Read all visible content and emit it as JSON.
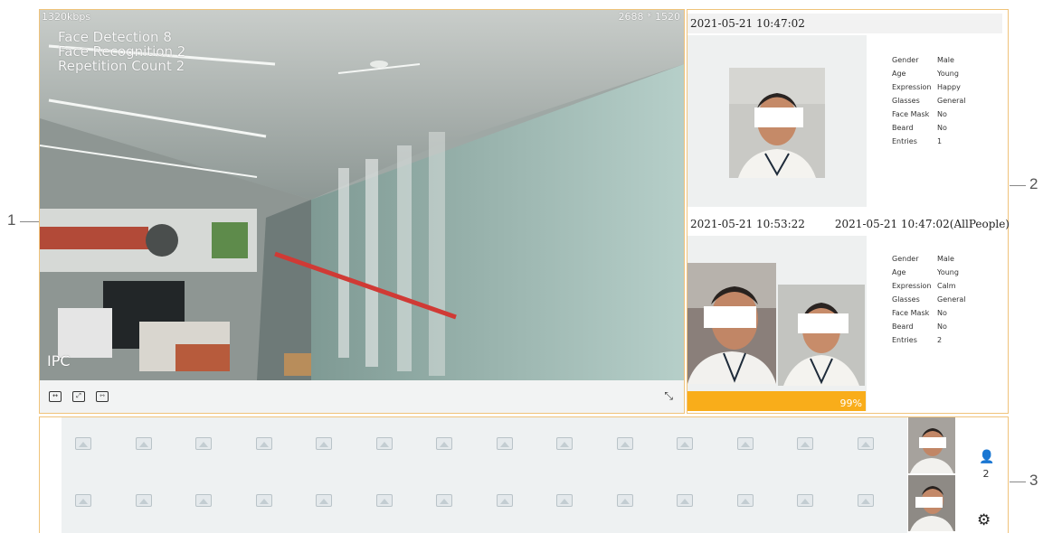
{
  "callouts": {
    "one": "1",
    "two": "2",
    "three": "3"
  },
  "video": {
    "bitrate": "1320kbps",
    "resolution": "2688 * 1520",
    "stats": {
      "face_detection": "Face Detection  8",
      "face_recognition": "Face Recognition  2",
      "repetition_count": "Repetition Count  2"
    },
    "channel_label": "IPC",
    "toolbar": {
      "btn1_icon": "stretch-icon",
      "btn2_icon": "zoom-icon",
      "btn3_icon": "ratio-icon",
      "fullscreen_icon": "fullscreen-icon",
      "btn1_glyph": "↔",
      "btn2_glyph": "⤢",
      "btn3_glyph": "⇿",
      "fullscreen_glyph": "⤡"
    }
  },
  "snapshot": {
    "timestamp": "2021-05-21 10:47:02",
    "attributes": [
      {
        "key": "Gender",
        "value": "Male"
      },
      {
        "key": "Age",
        "value": "Young"
      },
      {
        "key": "Expression",
        "value": "Happy"
      },
      {
        "key": "Glasses",
        "value": "General"
      },
      {
        "key": "Face Mask",
        "value": "No"
      },
      {
        "key": "Beard",
        "value": "No"
      },
      {
        "key": "Entries",
        "value": "1"
      }
    ]
  },
  "match": {
    "timestamp_left": "2021-05-21 10:53:22",
    "timestamp_right": "2021-05-21 10:47:02(AllPeople)",
    "similarity": "99%",
    "similarity_fraction": 0.99,
    "attributes": [
      {
        "key": "Gender",
        "value": "Male"
      },
      {
        "key": "Age",
        "value": "Young"
      },
      {
        "key": "Expression",
        "value": "Calm"
      },
      {
        "key": "Glasses",
        "value": "General"
      },
      {
        "key": "Face Mask",
        "value": "No"
      },
      {
        "key": "Beard",
        "value": "No"
      },
      {
        "key": "Entries",
        "value": "2"
      }
    ]
  },
  "strip": {
    "people_count": "2",
    "people_icon": "person-icon",
    "settings_icon": "gear-icon",
    "people_glyph": "👤",
    "settings_glyph": "⚙"
  },
  "colors": {
    "accent": "#f9ad1a",
    "panel_border": "#f0c37a",
    "empty_cell": "#eef1f2"
  }
}
